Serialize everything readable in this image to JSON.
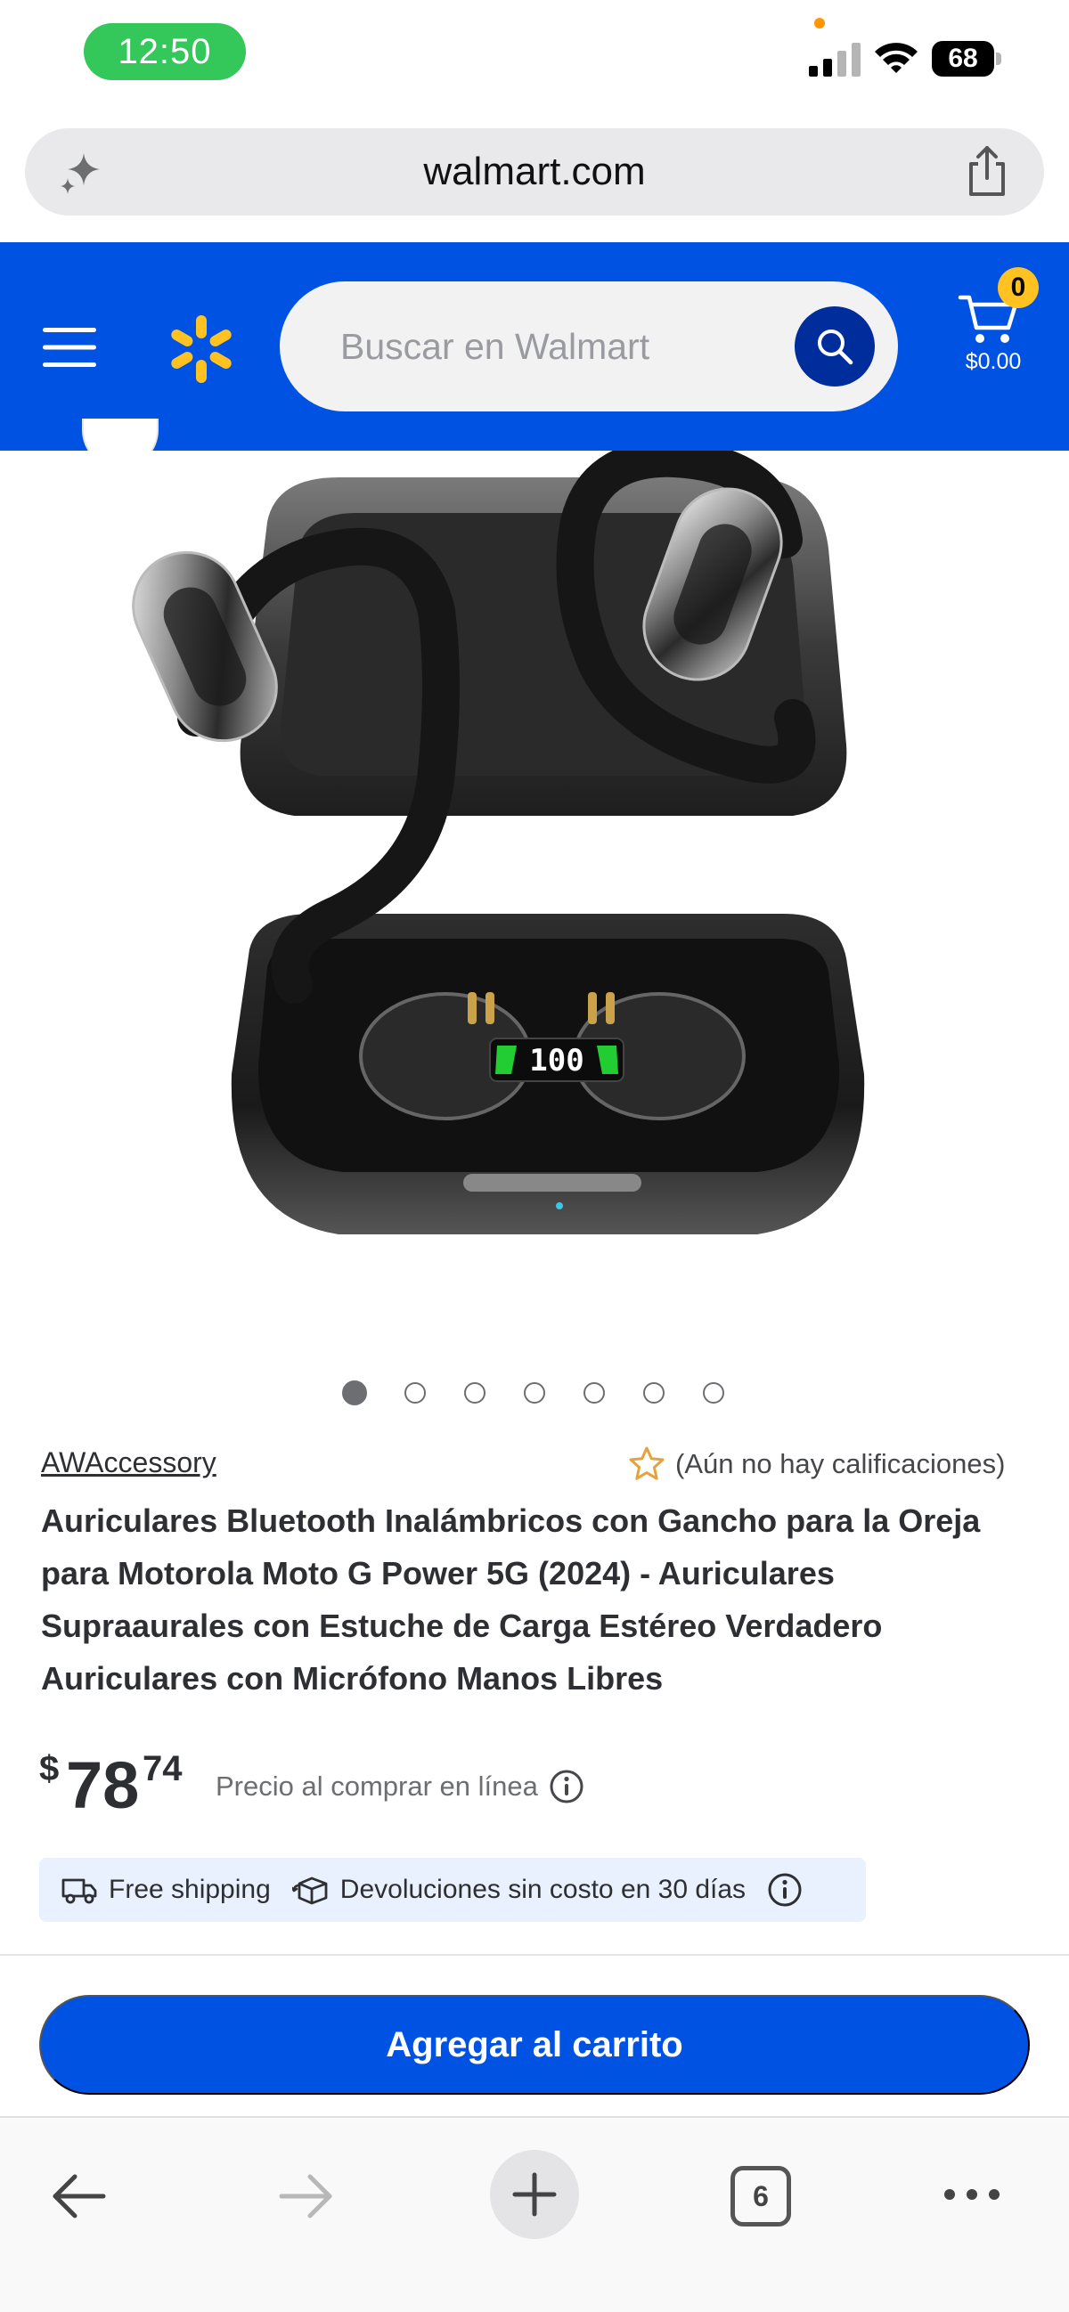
{
  "status_bar": {
    "time": "12:50",
    "battery": "68"
  },
  "browser": {
    "url": "walmart.com",
    "tabs_count": "6"
  },
  "header": {
    "search_placeholder": "Buscar en Walmart",
    "cart_count": "0",
    "cart_total": "$0.00",
    "brand_color": "#0053e2",
    "accent_color": "#ffc220"
  },
  "carousel": {
    "total": 7,
    "active_index": 0
  },
  "product": {
    "seller": "AWAccessory",
    "rating_text": "(Aún no hay calificaciones)",
    "title": "Auriculares Bluetooth Inalámbricos con Gancho para la Oreja para Motorola Moto G Power 5G (2024) - Auriculares Supraaurales con Estuche de Carga Estéreo Verdadero Auriculares con Micrófono Manos Libres",
    "price_symbol": "$",
    "price_dollars": "78",
    "price_cents": "74",
    "price_note": "Precio al comprar en línea",
    "display_reading": "100"
  },
  "benefits": {
    "shipping": "Free shipping",
    "returns": "Devoluciones sin costo en 30 días"
  },
  "actions": {
    "add_to_cart": "Agregar al carrito"
  },
  "icons": [
    "sparkle-icon",
    "share-icon",
    "menu-icon",
    "walmart-spark-icon",
    "search-icon",
    "cart-icon",
    "star-outline-icon",
    "info-icon",
    "truck-icon",
    "return-box-icon",
    "back-arrow-icon",
    "forward-arrow-icon",
    "plus-icon",
    "tabs-icon",
    "more-icon"
  ]
}
